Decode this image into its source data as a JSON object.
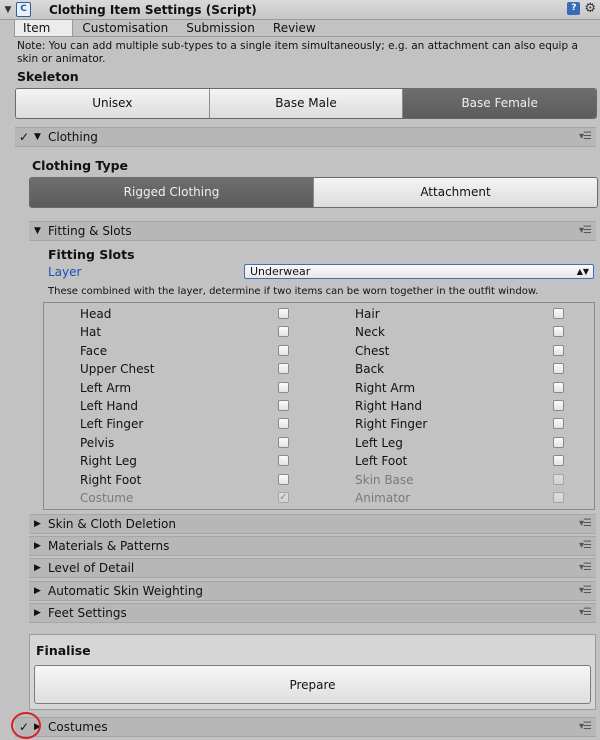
{
  "window": {
    "title": "Clothing Item Settings (Script)",
    "script_icon": "script-icon",
    "help_icon": "book-icon",
    "settings_icon": "gear-icon"
  },
  "tabs": [
    "Item",
    "Customisation",
    "Submission",
    "Review"
  ],
  "active_tab": "Item",
  "note": "Note: You can add multiple sub-types to a single item simultaneously; e.g. an attachment can also equip a skin or animator.",
  "skeleton": {
    "label": "Skeleton",
    "options": [
      "Unisex",
      "Base Male",
      "Base Female"
    ],
    "selected": "Base Female"
  },
  "clothing": {
    "label": "Clothing",
    "enabled": true,
    "check_glyph": "✓",
    "type_label": "Clothing Type",
    "type_options": [
      "Rigged Clothing",
      "Attachment"
    ],
    "type_selected": "Rigged Clothing"
  },
  "fitting": {
    "section_label": "Fitting & Slots",
    "slots_label": "Fitting Slots",
    "layer_label": "Layer",
    "layer_value": "Underwear",
    "combined_note": "These combined with the layer, determine if two items can be worn together in the outfit window.",
    "slots_left": [
      {
        "name": "Head",
        "checked": false,
        "disabled": false
      },
      {
        "name": "Hat",
        "checked": false,
        "disabled": false
      },
      {
        "name": "Face",
        "checked": false,
        "disabled": false
      },
      {
        "name": "Upper Chest",
        "checked": false,
        "disabled": false
      },
      {
        "name": "Left Arm",
        "checked": false,
        "disabled": false
      },
      {
        "name": "Left Hand",
        "checked": false,
        "disabled": false
      },
      {
        "name": "Left Finger",
        "checked": false,
        "disabled": false
      },
      {
        "name": "Pelvis",
        "checked": false,
        "disabled": false
      },
      {
        "name": "Right Leg",
        "checked": false,
        "disabled": false
      },
      {
        "name": "Right Foot",
        "checked": false,
        "disabled": false
      },
      {
        "name": "Costume",
        "checked": true,
        "disabled": true
      }
    ],
    "slots_right": [
      {
        "name": "Hair",
        "checked": false,
        "disabled": false
      },
      {
        "name": "Neck",
        "checked": false,
        "disabled": false
      },
      {
        "name": "Chest",
        "checked": false,
        "disabled": false
      },
      {
        "name": "Back",
        "checked": false,
        "disabled": false
      },
      {
        "name": "Right Arm",
        "checked": false,
        "disabled": false
      },
      {
        "name": "Right Hand",
        "checked": false,
        "disabled": false
      },
      {
        "name": "Right Finger",
        "checked": false,
        "disabled": false
      },
      {
        "name": "Left Leg",
        "checked": false,
        "disabled": false
      },
      {
        "name": "Left Foot",
        "checked": false,
        "disabled": false
      },
      {
        "name": "Skin Base",
        "checked": false,
        "disabled": true
      },
      {
        "name": "Animator",
        "checked": false,
        "disabled": true
      }
    ]
  },
  "sections": [
    "Skin & Cloth Deletion",
    "Materials & Patterns",
    "Level of Detail",
    "Automatic Skin Weighting",
    "Feet Settings"
  ],
  "finalise": {
    "label": "Finalise",
    "button": "Prepare"
  },
  "costumes": {
    "label": "Costumes",
    "enabled": true,
    "check_glyph": "✓"
  },
  "highlight_color": "#d8202a"
}
